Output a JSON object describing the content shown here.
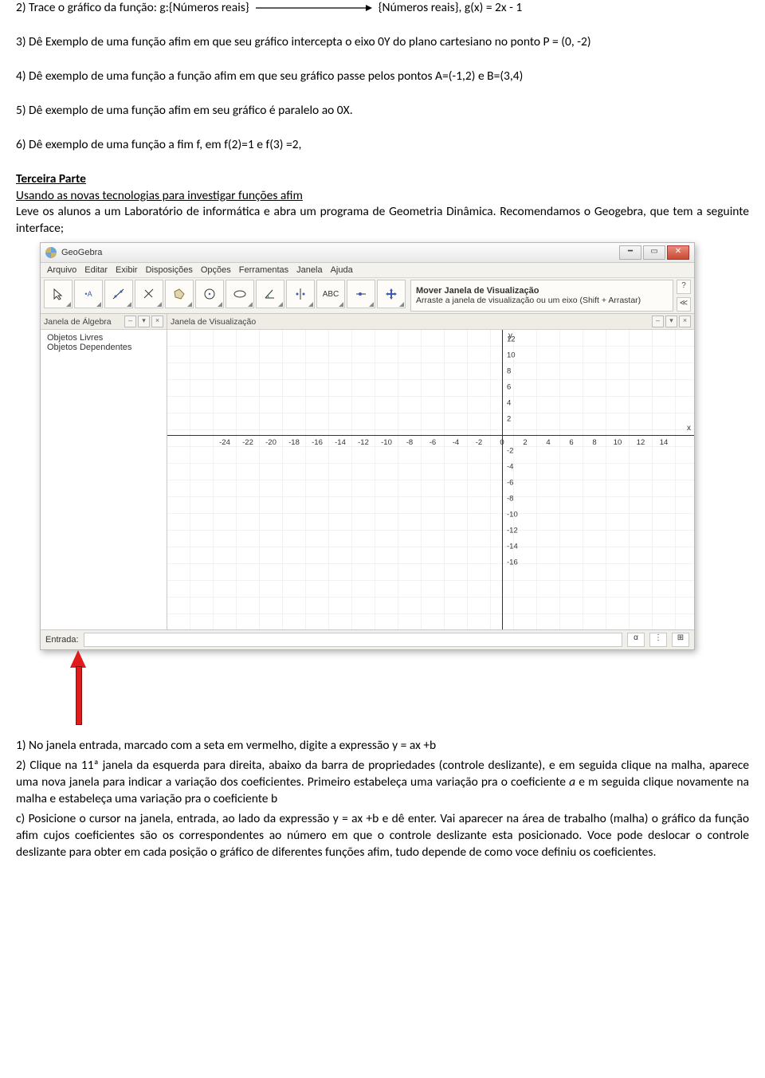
{
  "doc": {
    "q2_a": "2) Trace o gráfico da função: g:{Números reais}",
    "q2_b": "{Números reais}, g(x) = 2x - 1",
    "q3": "3) Dê Exemplo de uma função afim em que seu gráfico intercepta o eixo 0Y do plano cartesiano no ponto P = (0, -2)",
    "q4": "4) Dê exemplo de uma função a função afim em que seu gráfico passe pelos pontos A=(-1,2) e B=(3,4)",
    "q5": "5) Dê exemplo de uma função afim em seu gráfico é paralelo ao 0X.",
    "q6": "6) Dê exemplo de uma função a fim f, em f(2)=1 e f(3) =2,",
    "terceira": "Terceira Parte",
    "subt": "Usando as novas tecnologias para investigar funções afim",
    "intro": "Leve os alunos a um Laboratório de informática e abra um programa de Geometria Dinâmica. Recomendamos o Geogebra, que tem a seguinte interface;",
    "p1": "1) No janela entrada, marcado com a seta em vermelho, digite a expressão y = ax +b",
    "p2": "2) Clique na 11ª janela da esquerda para direita, abaixo da barra de propriedades (controle deslizante), e em seguida clique na malha, aparece uma nova janela para indicar a variação dos coeficientes. Primeiro estabeleça uma variação pra o coeficiente ",
    "p2_a": "a",
    "p2_mid": " e m seguida clique novamente na malha e estabeleça uma variação pra o coeficiente b",
    "pc": "c) Posicione o cursor na janela, entrada, ao lado da expressão y = ax +b e dê enter. Vai aparecer na área de trabalho (malha) o gráfico da função afim cujos coeficientes são os correspondentes ao número em que o controle deslizante esta posicionado. Voce pode deslocar o controle deslizante para obter em cada posição o gráfico de diferentes funções afim, tudo depende de como voce definiu os coeficientes."
  },
  "gg": {
    "title": "GeoGebra",
    "menu": [
      "Arquivo",
      "Editar",
      "Exibir",
      "Disposições",
      "Opções",
      "Ferramentas",
      "Janela",
      "Ajuda"
    ],
    "toolhelp_title": "Mover Janela de Visualização",
    "toolhelp_sub": "Arraste a janela de visualização ou um eixo (Shift + Arrastar)",
    "algebra_hdr": "Janela de Álgebra",
    "view_hdr": "Janela de Visualização",
    "algebra_items": [
      "Objetos Livres",
      "Objetos Dependentes"
    ],
    "entrada_label": "Entrada:",
    "x_ticks": [
      "-24",
      "-22",
      "-20",
      "-18",
      "-16",
      "-14",
      "-12",
      "-10",
      "-8",
      "-6",
      "-4",
      "-2",
      "0",
      "2",
      "4",
      "6",
      "8",
      "10",
      "12",
      "14"
    ],
    "y_ticks_pos": [
      "12",
      "10",
      "8",
      "6",
      "4",
      "2"
    ],
    "y_ticks_neg": [
      "-2",
      "-4",
      "-6",
      "-8",
      "-10",
      "-12",
      "-14",
      "-16"
    ],
    "axis_x_label": "x",
    "axis_y_label": "y",
    "zero": "0"
  }
}
